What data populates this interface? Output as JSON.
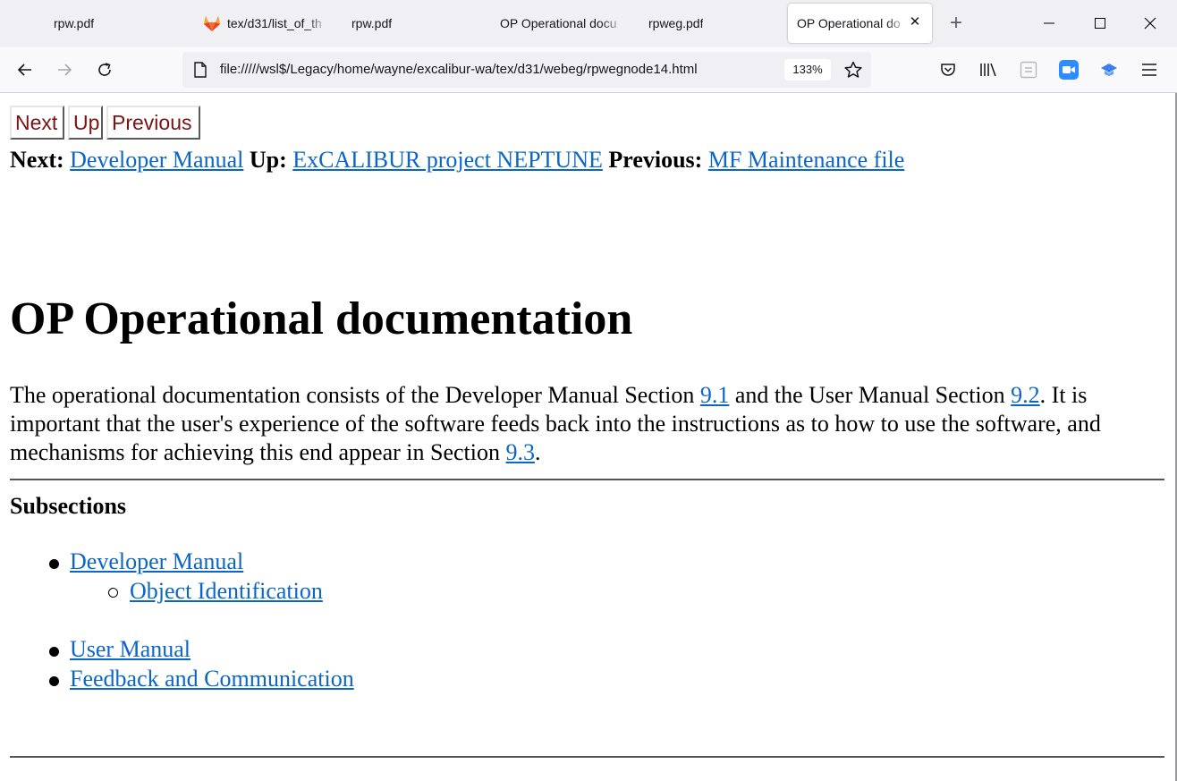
{
  "tabs": [
    {
      "label": "rpw.pdf",
      "icon": "pdf-icon"
    },
    {
      "label": "tex/d31/list_of_th",
      "icon": "gitlab-icon"
    },
    {
      "label": "rpw.pdf",
      "icon": "pdf-icon"
    },
    {
      "label": "OP Operational docu",
      "icon": "page-icon"
    },
    {
      "label": "rpweg.pdf",
      "icon": "pdf-icon"
    },
    {
      "label": "OP Operational do",
      "icon": "page-icon",
      "active": true
    }
  ],
  "toolbar": {
    "url": "file://///wsl$/Legacy/home/wayne/excalibur-wa/tex/d31/webeg/rpwegnode14.html",
    "zoom": "133%"
  },
  "page": {
    "nav_buttons": [
      "Next",
      "Up",
      "Previous"
    ],
    "nav_next_label": "Next:",
    "nav_next_link": "Developer Manual",
    "nav_up_label": "Up:",
    "nav_up_link": "ExCALIBUR project NEPTUNE",
    "nav_prev_label": "Previous:",
    "nav_prev_link": "MF Maintenance file",
    "title": "OP Operational documentation",
    "para": {
      "t1": "The operational documentation consists of the Developer Manual Section ",
      "l1": "9.1",
      "t2": " and the User Manual Section ",
      "l2": "9.2",
      "t3": ". It is important that the user's experience of the software feeds back into the instructions as to how to use the software, and mechanisms for achieving this end appear in Section ",
      "l3": "9.3",
      "t4": "."
    },
    "subsections_heading": "Subsections",
    "subsections": [
      {
        "label": "Developer Manual",
        "children": [
          "Object Identification"
        ]
      },
      {
        "label": "User Manual"
      },
      {
        "label": "Feedback and Communication"
      }
    ]
  },
  "colors": {
    "link": "#0b66c8",
    "nav_button_text": "#7a1414"
  }
}
